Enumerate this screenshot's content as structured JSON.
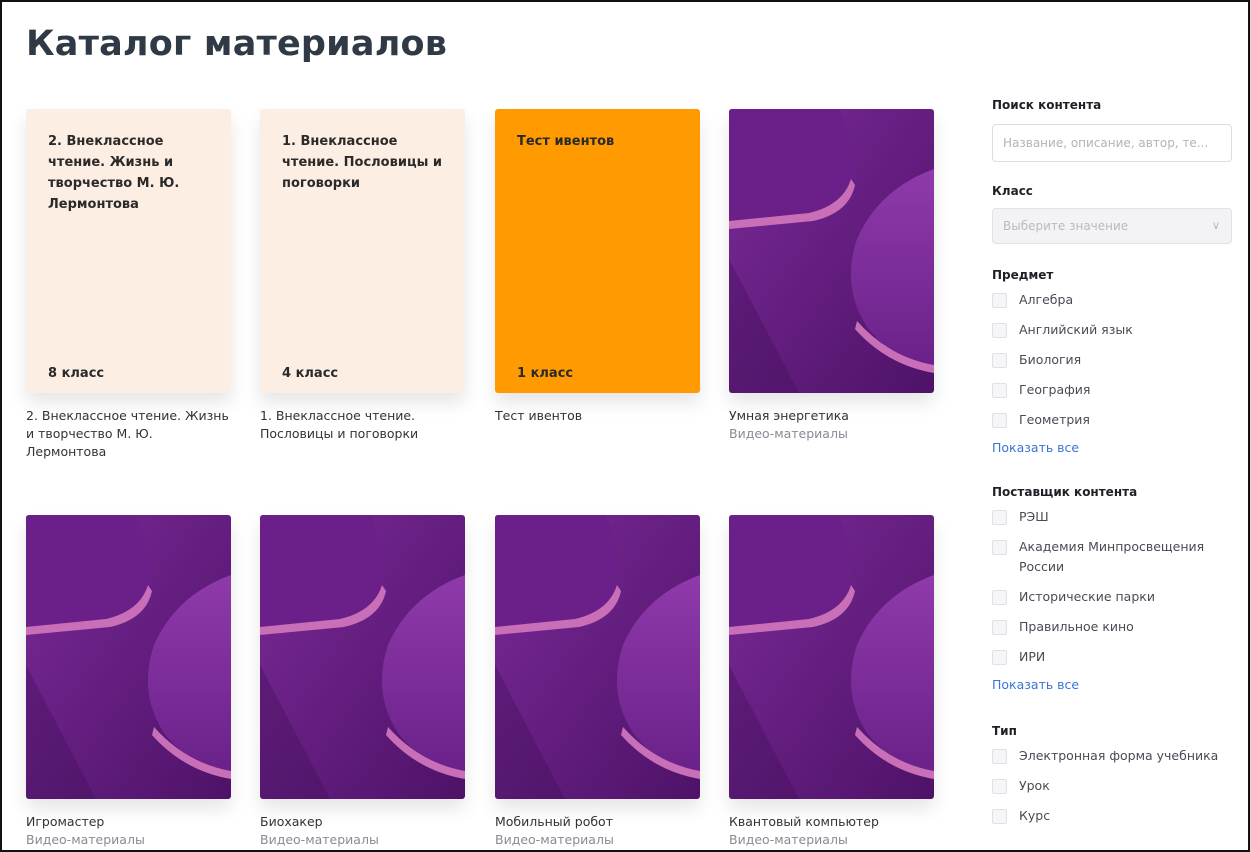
{
  "page": {
    "title": "Каталог материалов"
  },
  "cards": [
    {
      "cover_title": "2. Внеклассное чтение. Жизнь и творчество М. Ю. Лермонтова",
      "grade": "8 класс",
      "name": "2. Внеклассное чтение. Жизнь и творчество М. Ю. Лермонтова",
      "subtitle": ""
    },
    {
      "cover_title": "1. Внеклассное чтение. Пословицы и поговорки",
      "grade": "4 класс",
      "name": "1. Внеклассное чтение. Пословицы и поговорки",
      "subtitle": ""
    },
    {
      "cover_title": "Тест ивентов",
      "grade": "1 класс",
      "name": "Тест ивентов",
      "subtitle": ""
    },
    {
      "name": "Умная энергетика",
      "subtitle": "Видео-материалы"
    },
    {
      "name": "Игромастер",
      "subtitle": "Видео-материалы"
    },
    {
      "name": "Биохакер",
      "subtitle": "Видео-материалы"
    },
    {
      "name": "Мобильный робот",
      "subtitle": "Видео-материалы"
    },
    {
      "name": "Квантовый компьютер",
      "subtitle": "Видео-материалы"
    }
  ],
  "colors": {
    "cover_light": "#fdeee4",
    "cover_orange": "#ff9a00",
    "cover_purple": "#6a1f86",
    "cover_pink": "#c86fb8",
    "link": "#3b74d6"
  },
  "sidebar": {
    "search": {
      "label": "Поиск контента",
      "placeholder": "Название, описание, автор, те..."
    },
    "grade": {
      "label": "Класс",
      "placeholder": "Выберите значение"
    },
    "subject": {
      "label": "Предмет",
      "options": [
        "Алгебра",
        "Английский язык",
        "Биология",
        "География",
        "Геометрия"
      ],
      "show_all": "Показать все"
    },
    "provider": {
      "label": "Поставщик контента",
      "options": [
        "РЭШ",
        "Академия Минпросвещения России",
        "Исторические парки",
        "Правильное кино",
        "ИРИ"
      ],
      "show_all": "Показать все"
    },
    "type": {
      "label": "Тип",
      "options": [
        "Электронная форма учебника",
        "Урок",
        "Курс"
      ]
    }
  }
}
